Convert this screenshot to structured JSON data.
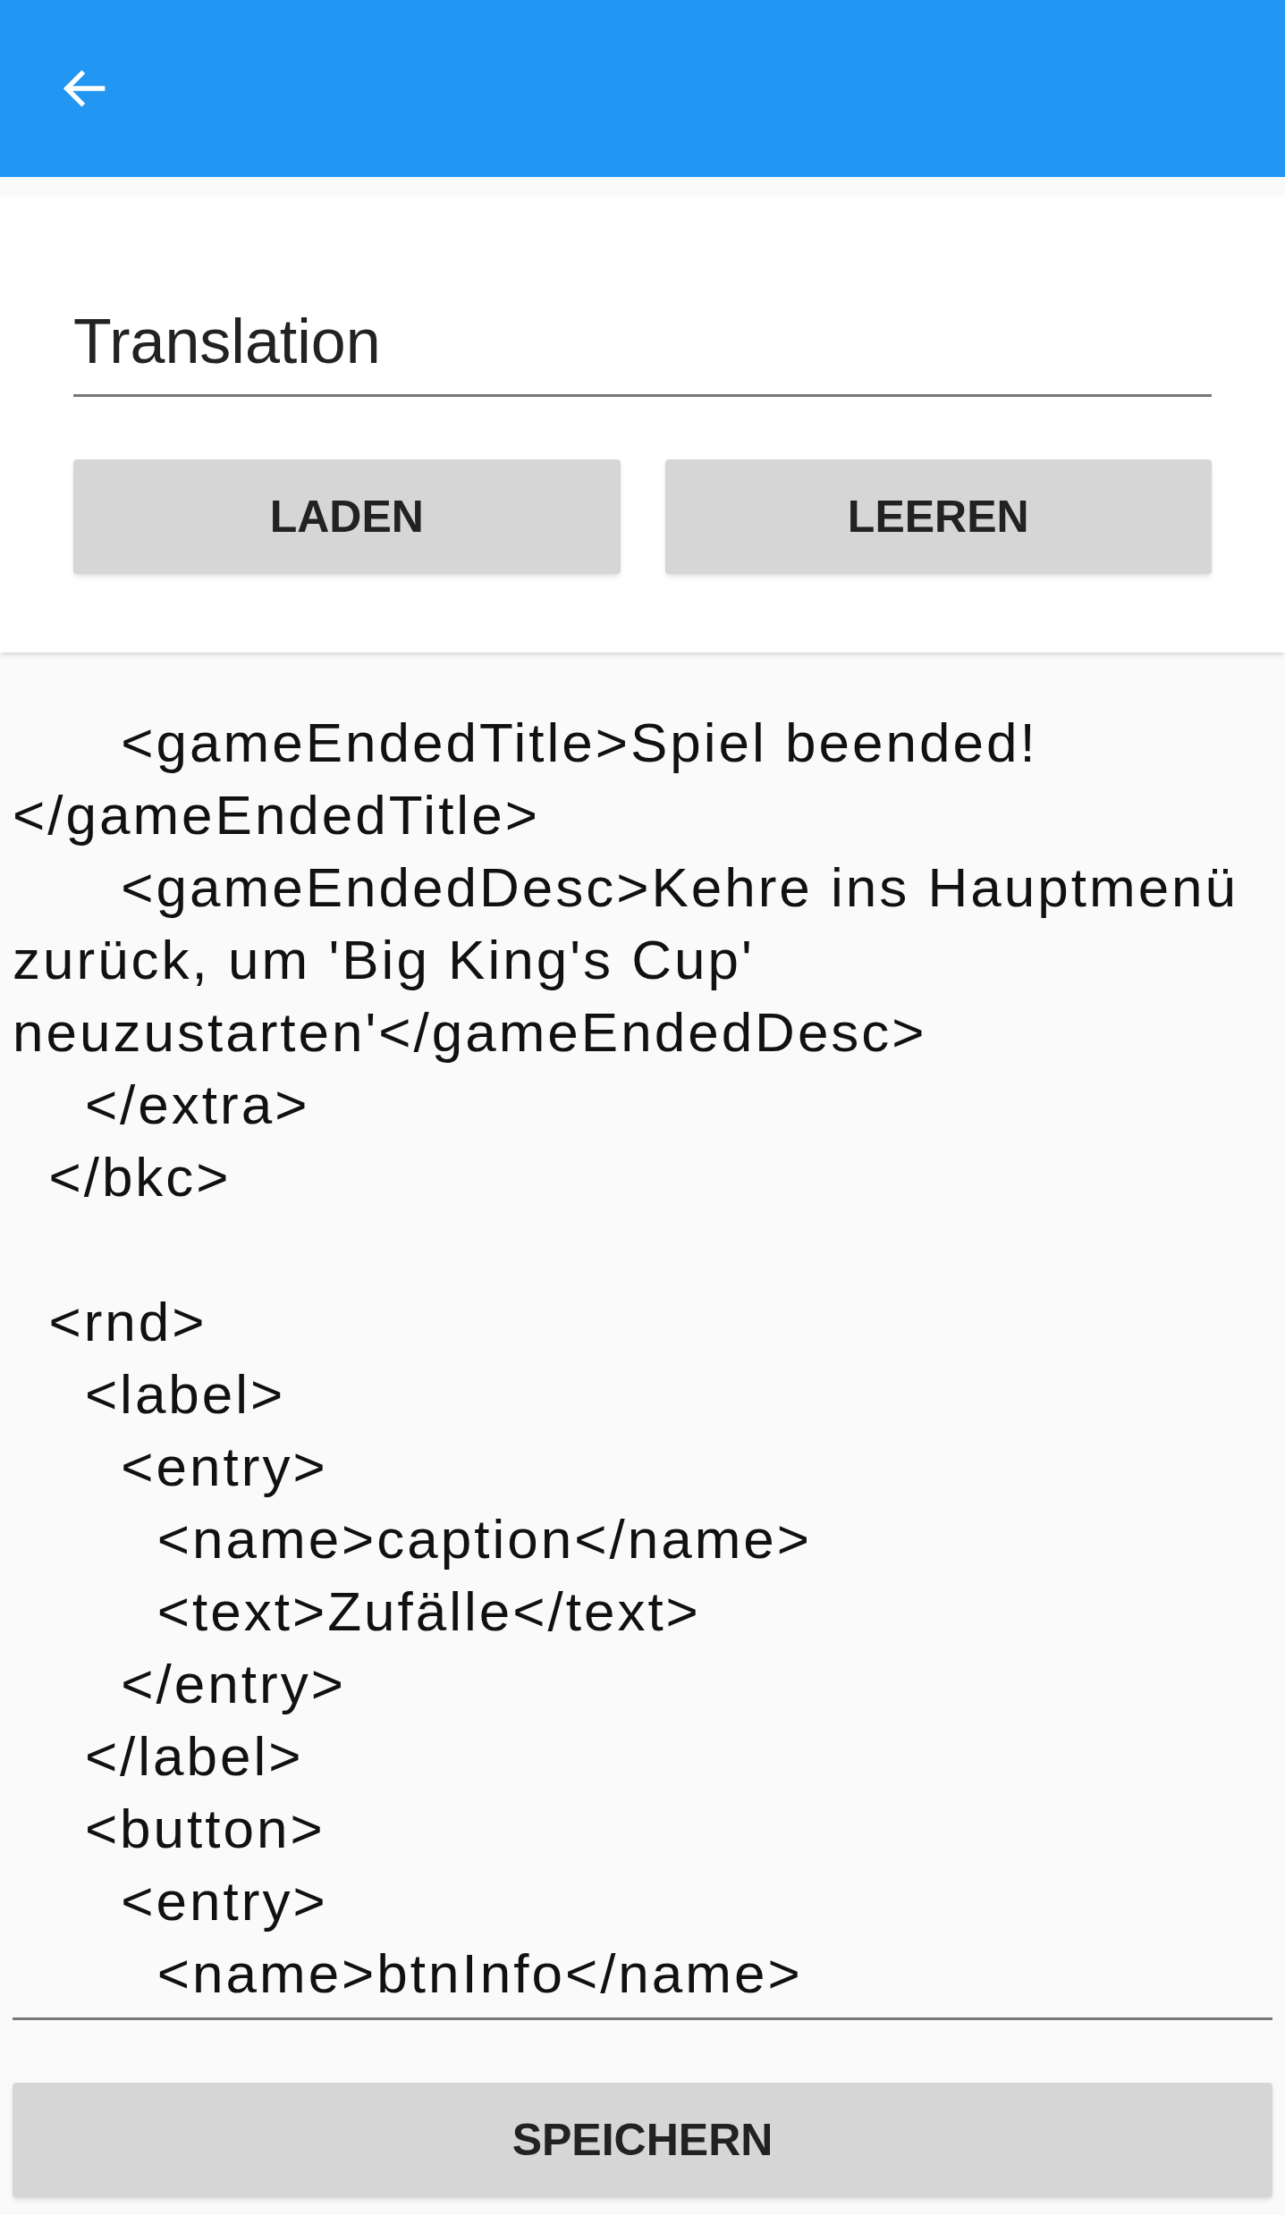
{
  "form": {
    "field": {
      "value": "Translation"
    },
    "buttons": [
      "LADEN",
      "LEEREN"
    ]
  },
  "editor": {
    "value": "      <gameEndedTitle>Spiel beended!</gameEndedTitle>\n      <gameEndedDesc>Kehre ins Hauptmenü zurück, um 'Big King's Cup' neuzustarten'</gameEndedDesc>\n    </extra>\n  </bkc>\n\n  <rnd>\n    <label>\n      <entry>\n        <name>caption</name>\n        <text>Zufälle</text>\n      </entry>\n    </label>\n    <button>\n      <entry>\n        <name>btnInfo</name>"
  },
  "save_button": "SPEICHERN"
}
